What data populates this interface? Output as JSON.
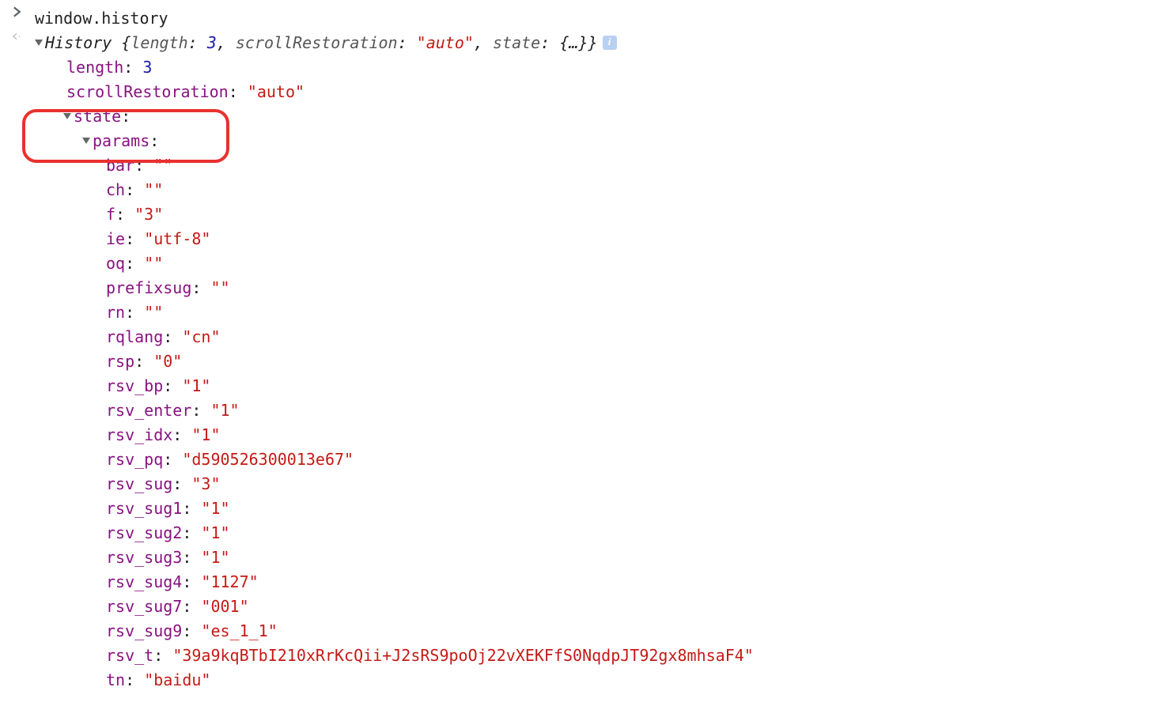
{
  "console": {
    "input": "window.history",
    "summary": {
      "className": "History",
      "length_key": "length",
      "length_val": "3",
      "scrollRestoration_key": "scrollRestoration",
      "scrollRestoration_val": "\"auto\"",
      "state_key": "state",
      "state_val": "{…}"
    },
    "length": {
      "key": "length",
      "val": "3"
    },
    "scrollRestoration": {
      "key": "scrollRestoration",
      "val": "\"auto\""
    },
    "state_key": "state",
    "params_key": "params",
    "params": [
      {
        "key": "bar",
        "val": "\"\""
      },
      {
        "key": "ch",
        "val": "\"\""
      },
      {
        "key": "f",
        "val": "\"3\""
      },
      {
        "key": "ie",
        "val": "\"utf-8\""
      },
      {
        "key": "oq",
        "val": "\"\""
      },
      {
        "key": "prefixsug",
        "val": "\"\""
      },
      {
        "key": "rn",
        "val": "\"\""
      },
      {
        "key": "rqlang",
        "val": "\"cn\""
      },
      {
        "key": "rsp",
        "val": "\"0\""
      },
      {
        "key": "rsv_bp",
        "val": "\"1\""
      },
      {
        "key": "rsv_enter",
        "val": "\"1\""
      },
      {
        "key": "rsv_idx",
        "val": "\"1\""
      },
      {
        "key": "rsv_pq",
        "val": "\"d590526300013e67\""
      },
      {
        "key": "rsv_sug",
        "val": "\"3\""
      },
      {
        "key": "rsv_sug1",
        "val": "\"1\""
      },
      {
        "key": "rsv_sug2",
        "val": "\"1\""
      },
      {
        "key": "rsv_sug3",
        "val": "\"1\""
      },
      {
        "key": "rsv_sug4",
        "val": "\"1127\""
      },
      {
        "key": "rsv_sug7",
        "val": "\"001\""
      },
      {
        "key": "rsv_sug9",
        "val": "\"es_1_1\""
      },
      {
        "key": "rsv_t",
        "val": "\"39a9kqBTbI210xRrKcQii+J2sRS9poOj22vXEKFfS0NqdpJT92gx8mhsaF4\""
      },
      {
        "key": "tn",
        "val": "\"baidu\""
      }
    ]
  }
}
